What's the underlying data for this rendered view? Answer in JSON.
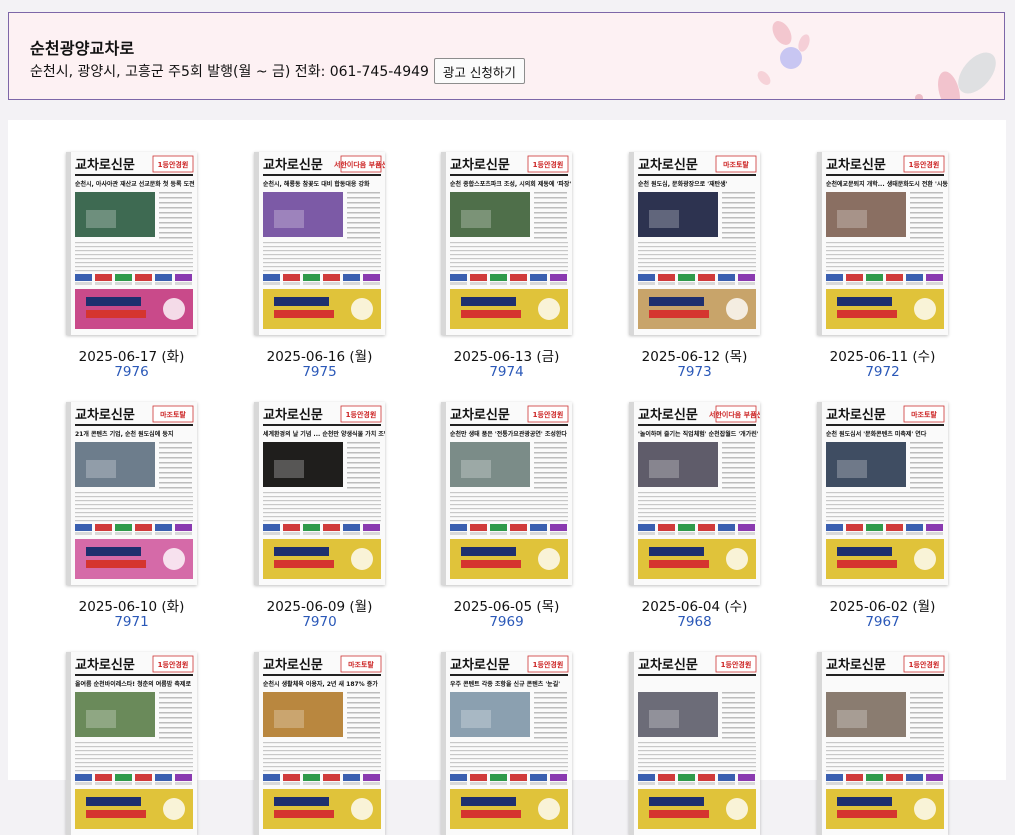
{
  "header": {
    "title": "순천광양교차로",
    "info": "순천시, 광양시, 고흥군 주5회 발행(월 ~ 금) 전화: 061-745-4949",
    "ad_button": "광고 신청하기"
  },
  "newspaper_masthead": "교차로신문",
  "issues": [
    {
      "date": "2025-06-17 (화)",
      "id": "7976",
      "headline": "순천시, 아사아관 재산교 선교문화 첫 등록 도전",
      "badge": "1등안경원",
      "photo": "#3e6a52",
      "ad": "#c94a8a"
    },
    {
      "date": "2025-06-16 (월)",
      "id": "7975",
      "headline": "순천시, 해룡동 참꽃도 대비 합동대응 강화",
      "badge": "서한이다음 부품신",
      "photo": "#7c5aa6",
      "ad": "#e0c33a"
    },
    {
      "date": "2025-06-13 (금)",
      "id": "7974",
      "headline": "순천 종합스포츠파크 조성, 시의회 제동에 '파장'",
      "badge": "1등안경원",
      "photo": "#4f6f4a",
      "ad": "#e0c33a"
    },
    {
      "date": "2025-06-12 (목)",
      "id": "7973",
      "headline": "순천 원도심, 문화광장으로 '재탄생'",
      "badge": "마조토탈",
      "photo": "#2d3350",
      "ad": "#c8a46a"
    },
    {
      "date": "2025-06-11 (수)",
      "id": "7972",
      "headline": "순천에교문퇴지 개학... 생태문화도시 전환 '시동'",
      "badge": "1등안경원",
      "photo": "#8a6f62",
      "ad": "#e0c33a"
    },
    {
      "date": "2025-06-10 (화)",
      "id": "7971",
      "headline": "21개 콘텐츠 기업, 순천 원도심에 둥지",
      "badge": "마조토탈",
      "photo": "#6d7d8c",
      "ad": "#d56aa8"
    },
    {
      "date": "2025-06-09 (월)",
      "id": "7970",
      "headline": "세계환경의 날 기념 ... 순천만 양생식물 가치 조명",
      "badge": "1등안경원",
      "photo": "#1f1e1c",
      "ad": "#e0c33a"
    },
    {
      "date": "2025-06-05 (목)",
      "id": "7969",
      "headline": "순천만 생태 품은 '전통가요관광공연' 조성한다",
      "badge": "1등안경원",
      "photo": "#7b8c88",
      "ad": "#e0c33a"
    },
    {
      "date": "2025-06-04 (수)",
      "id": "7968",
      "headline": "'놀이하며 즐기는 직업체험' 순천잡월드 '개가린'",
      "badge": "서한이다음 부품신",
      "photo": "#5f5c6a",
      "ad": "#e0c33a"
    },
    {
      "date": "2025-06-02 (월)",
      "id": "7967",
      "headline": "순천 원도심서 '문화콘텐츠 미축제' 연다",
      "badge": "마조토탈",
      "photo": "#3f4d62",
      "ad": "#e0c33a"
    },
    {
      "date": "",
      "id": "",
      "headline": "올여름 순천바이레스타! 청춘의 여름밤 축제로",
      "badge": "1등안경원",
      "photo": "#6a8a5a",
      "ad": "#e0c33a"
    },
    {
      "date": "",
      "id": "",
      "headline": "순천시 생활체육 이용자, 2년 새 187% 증가",
      "badge": "마조토탈",
      "photo": "#b9873f",
      "ad": "#e0c33a"
    },
    {
      "date": "",
      "id": "",
      "headline": "우주 콘텐트 각종 조항을 신규 콘텐츠 '눈길'",
      "badge": "1등안경원",
      "photo": "#8ba0b0",
      "ad": "#e0c33a"
    },
    {
      "date": "",
      "id": "",
      "headline": "",
      "badge": "1등안경원",
      "photo": "#6c6c78",
      "ad": "#e0c33a"
    },
    {
      "date": "",
      "id": "",
      "headline": "",
      "badge": "1등안경원",
      "photo": "#8a7c70",
      "ad": "#e0c33a"
    }
  ]
}
